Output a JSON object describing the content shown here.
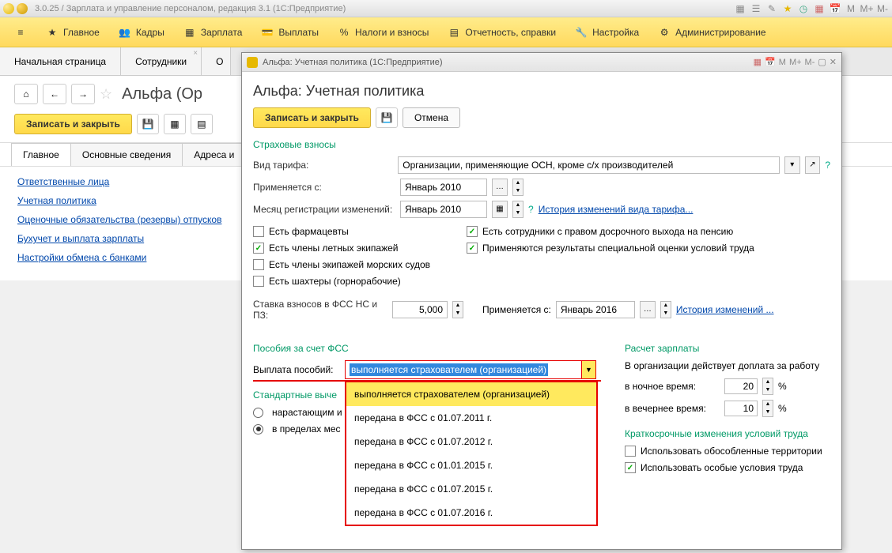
{
  "titlebar": {
    "text": "3.0.25 / Зарплата и управление персоналом, редакция 3.1  (1С:Предприятие)",
    "right_labels": [
      "M",
      "M+",
      "M-"
    ]
  },
  "main_menu": [
    "Главное",
    "Кадры",
    "Зарплата",
    "Выплаты",
    "Налоги и взносы",
    "Отчетность, справки",
    "Настройка",
    "Администрирование"
  ],
  "tabs": [
    "Начальная страница",
    "Сотрудники",
    "О"
  ],
  "page": {
    "title": "Альфа (Ор",
    "save_close": "Записать и закрыть"
  },
  "sub_tabs": [
    "Главное",
    "Основные сведения",
    "Адреса и"
  ],
  "links": [
    "Ответственные лица",
    "Учетная политика",
    "Оценочные обязательства (резервы) отпусков",
    "Бухучет и выплата зарплаты",
    "Настройки обмена с банками"
  ],
  "modal": {
    "win_title": "Альфа: Учетная политика  (1С:Предприятие)",
    "right_labels": [
      "M",
      "M+",
      "M-"
    ],
    "h1": "Альфа: Учетная политика",
    "save_close": "Записать и закрыть",
    "cancel": "Отмена",
    "section_insurance": "Страховые взносы",
    "tariff_label": "Вид тарифа:",
    "tariff_value": "Организации, применяющие ОСН, кроме с/х производителей",
    "applied_from_label": "Применяется с:",
    "applied_from_value": "Январь 2010",
    "reg_month_label": "Месяц регистрации изменений:",
    "reg_month_value": "Январь 2010",
    "history_tariff_link": "История изменений вида тарифа...",
    "checkboxes": {
      "pharmacists": "Есть фармацевты",
      "early_pension": "Есть сотрудники с правом досрочного выхода на пенсию",
      "flight_crew": "Есть члены летных экипажей",
      "special_assessment": "Применяются результаты специальной оценки условий труда",
      "sea_crew": "Есть члены экипажей морских судов",
      "miners": "Есть шахтеры (горнорабочие)"
    },
    "fss_rate_label": "Ставка взносов в ФСС НС и ПЗ:",
    "fss_rate_value": "5,000",
    "applied_from2_label": "Применяется с:",
    "applied_from2_value": "Январь 2016",
    "history_link": "История изменений ...",
    "section_fss": "Пособия за счет ФСС",
    "payment_label": "Выплата пособий:",
    "payment_selected": "выполняется страхователем (организацией)",
    "dropdown_options": [
      "выполняется страхователем (организацией)",
      "передана в ФСС с 01.07.2011 г.",
      "передана в ФСС с 01.07.2012 г.",
      "передана в ФСС с 01.01.2015 г.",
      "передана в ФСС с 01.07.2015 г.",
      "передана в ФСС с 01.07.2016 г."
    ],
    "section_deductions": "Стандартные выче",
    "radio1": "нарастающим и",
    "radio2": "в пределах мес",
    "section_salary": "Расчет зарплаты",
    "salary_text": "В организации действует доплата за работу",
    "night_label": "в ночное время:",
    "night_value": "20",
    "evening_label": "в вечернее время:",
    "evening_value": "10",
    "percent": "%",
    "section_conditions": "Краткосрочные изменения условий труда",
    "cb_territories": "Использовать обособленные территории",
    "cb_conditions": "Использовать особые условия труда"
  }
}
